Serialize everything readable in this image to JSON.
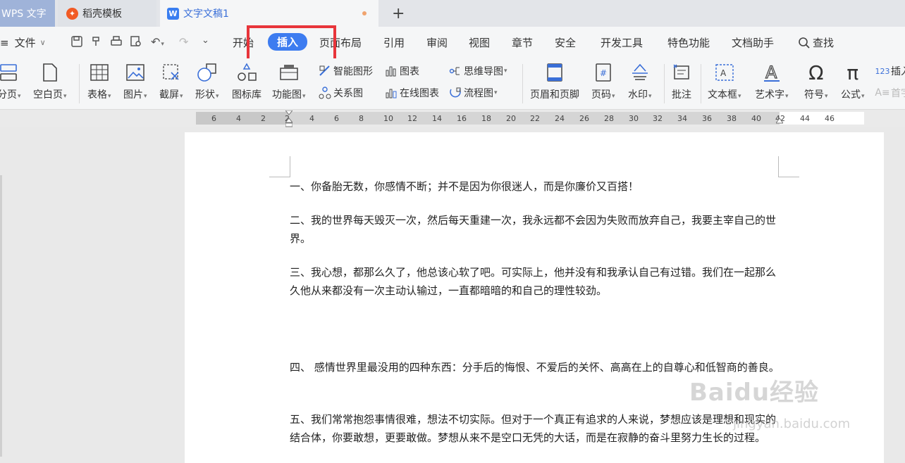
{
  "tabs": [
    {
      "label": "WPS 文字"
    },
    {
      "label": "稻壳模板"
    },
    {
      "label": "文字文稿1"
    }
  ],
  "menubar": {
    "file_label": "文件",
    "items": [
      "开始",
      "插入",
      "页面布局",
      "引用",
      "审阅",
      "视图",
      "章节",
      "安全",
      "开发工具",
      "特色功能",
      "文档助手"
    ],
    "search_label": "查找",
    "active": "插入"
  },
  "ribbon": {
    "page_break": "分页",
    "blank_page": "空白页",
    "table": "表格",
    "picture": "图片",
    "screenshot": "截屏",
    "shape": "形状",
    "icon_lib": "图标库",
    "func_chart": "功能图",
    "smart_shape": "智能图形",
    "chart": "图表",
    "mind_map": "思维导图",
    "relation": "关系图",
    "online_chart": "在线图表",
    "flowchart": "流程图",
    "header_footer": "页眉和页脚",
    "page_number": "页码",
    "watermark": "水印",
    "comment": "批注",
    "textbox": "文本框",
    "wordart": "艺术字",
    "symbol": "符号",
    "formula": "公式",
    "insert_num": "插入",
    "dropcap": "首字"
  },
  "ruler": {
    "numbers": [
      "6",
      "4",
      "2",
      "2",
      "4",
      "6",
      "8",
      "10",
      "12",
      "14",
      "16",
      "18",
      "20",
      "22",
      "24",
      "26",
      "28",
      "30",
      "32",
      "34",
      "36",
      "38",
      "40",
      "42",
      "44",
      "46"
    ]
  },
  "document": {
    "paragraphs": [
      "一、你备胎无数，你感情不断；并不是因为你很迷人，而是你廉价又百搭！",
      "二、我的世界每天毁灭一次，然后每天重建一次，我永远都不会因为失败而放弃自己，我要主宰自己的世界。",
      "三、我心想，都那么久了，他总该心软了吧。可实际上，他并没有和我承认自己有过错。我们在一起那么久他从来都没有一次主动认输过，一直都暗暗的和自己的理性较劲。",
      "四、 感情世界里最没用的四种东西：分手后的悔恨、不爱后的关怀、高高在上的自尊心和低智商的善良。",
      "五、我们常常抱怨事情很难，想法不切实际。但对于一个真正有追求的人来说，梦想应该是理想和现实的结合体，你要敢想，更要敢做。梦想从来不是空口无凭的大话，而是在寂静的奋斗里努力生长的过程。"
    ]
  },
  "watermark": {
    "text": "Baidu经验",
    "sub": "jingyan.baidu.com"
  },
  "colors": {
    "accent": "#3d7cf0",
    "highlight": "#e8353b"
  }
}
